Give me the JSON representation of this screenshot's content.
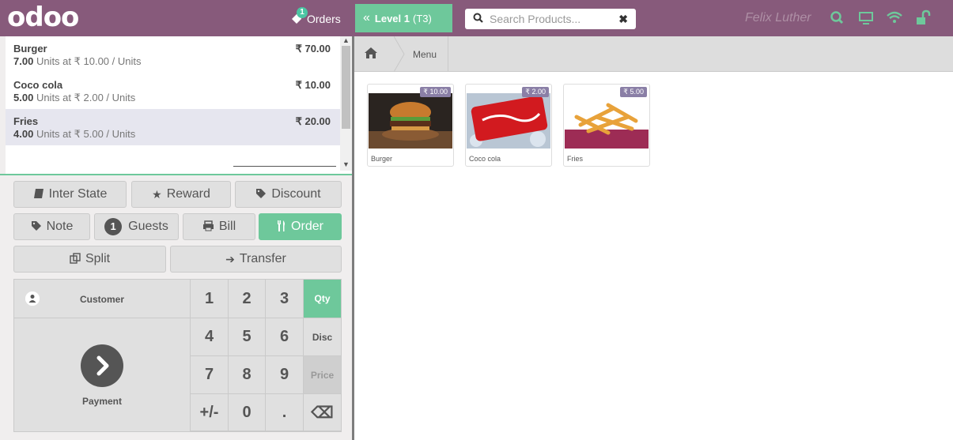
{
  "app": {
    "logo": "odoo"
  },
  "header": {
    "orders_label": "Orders",
    "orders_count": "1",
    "level_label": "Level 1",
    "level_table": "(T3)",
    "search_placeholder": "Search Products...",
    "user_name": "Felix Luther",
    "icons": [
      "search-icon",
      "monitor-icon",
      "wifi-icon",
      "unlock-icon"
    ]
  },
  "orderlines": [
    {
      "name": "Burger",
      "price": "₹ 70.00",
      "qty": "7.00",
      "unit_text": "Units at ₹ 10.00 / Units",
      "selected": false
    },
    {
      "name": "Coco cola",
      "price": "₹ 10.00",
      "qty": "5.00",
      "unit_text": "Units at ₹ 2.00 / Units",
      "selected": false
    },
    {
      "name": "Fries",
      "price": "₹ 20.00",
      "qty": "4.00",
      "unit_text": "Units at ₹ 5.00 / Units",
      "selected": true
    }
  ],
  "controls": {
    "inter_state": "Inter State",
    "reward": "Reward",
    "discount": "Discount",
    "note": "Note",
    "guests_count": "1",
    "guests": "Guests",
    "bill": "Bill",
    "order": "Order",
    "split": "Split",
    "transfer": "Transfer"
  },
  "numpad": {
    "customer": "Customer",
    "payment": "Payment",
    "keys": [
      "1",
      "2",
      "3",
      "Qty",
      "4",
      "5",
      "6",
      "Disc",
      "7",
      "8",
      "9",
      "Price",
      "+/-",
      "0",
      ".",
      "⌫"
    ],
    "active_mode": "Qty",
    "disabled_mode": "Price"
  },
  "breadcrumb": {
    "menu": "Menu"
  },
  "products": [
    {
      "name": "Burger",
      "price": "₹ 10.00"
    },
    {
      "name": "Coco cola",
      "price": "₹ 2.00"
    },
    {
      "name": "Fries",
      "price": "₹ 5.00"
    }
  ],
  "colors": {
    "topbar": "#875a7b",
    "accent_green": "#6ec89b",
    "price_tag": "#8a7fa6"
  }
}
